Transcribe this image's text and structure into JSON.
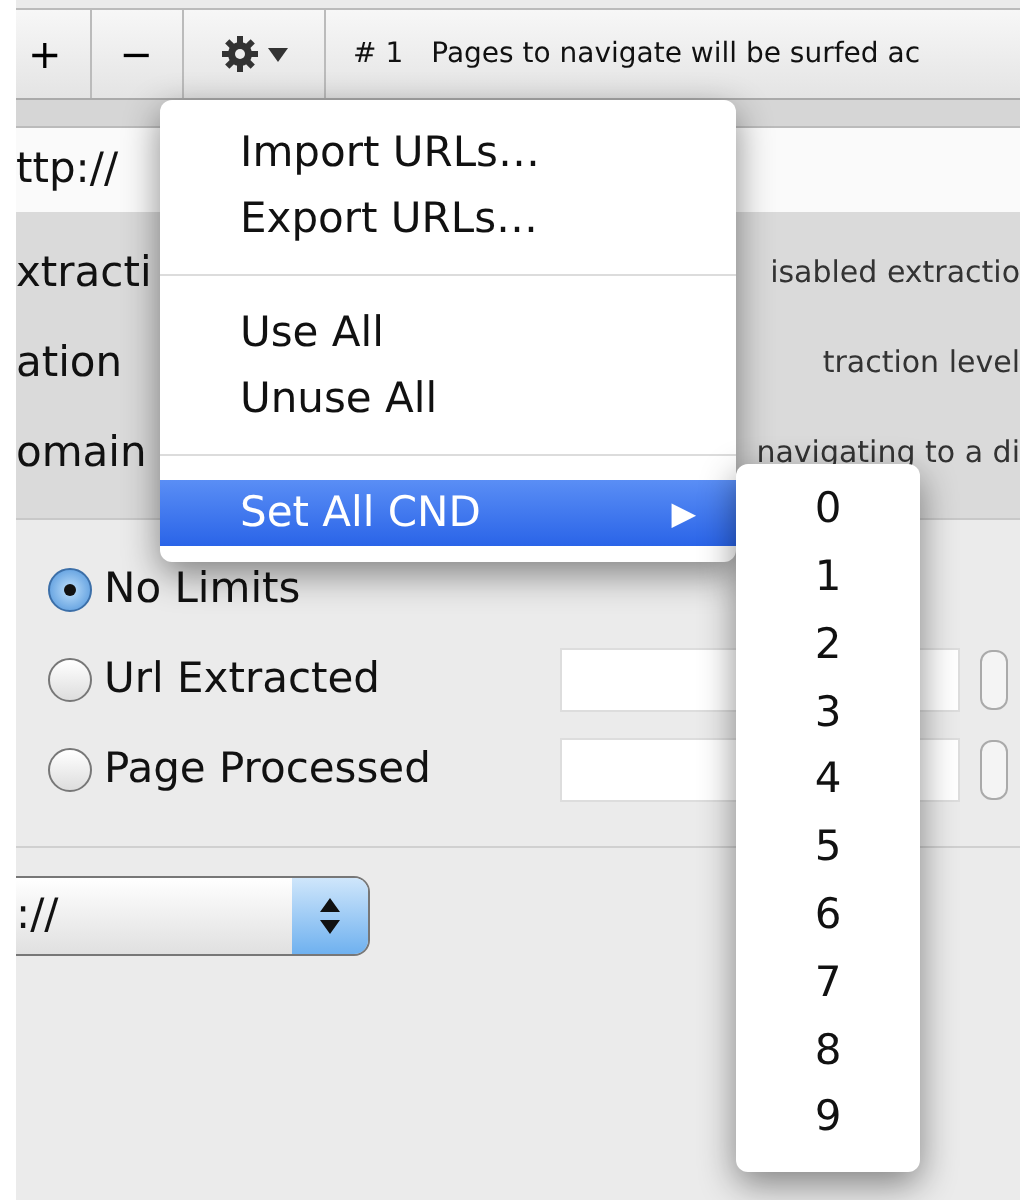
{
  "toolbar": {
    "buttons": [
      {
        "label": "+"
      },
      {
        "label": "−"
      }
    ],
    "index": "# 1",
    "message": "Pages  to navigate will be surfed ac"
  },
  "url_field": {
    "value": "ttp://"
  },
  "options": [
    {
      "label": "xtracti",
      "description": "isabled extractio"
    },
    {
      "label": "ation",
      "description": "traction level"
    },
    {
      "label": "omain",
      "description": "navigating to a di"
    }
  ],
  "limits": [
    {
      "label": "No Limits",
      "selected": true,
      "kind": "plain"
    },
    {
      "label": "Url Extracted",
      "selected": false,
      "kind": "field"
    },
    {
      "label": "Page Processed",
      "selected": false,
      "kind": "field"
    }
  ],
  "protocol_select": {
    "value": "://"
  },
  "menu": {
    "items": [
      {
        "kind": "item",
        "label": "Import URLs…",
        "selected": false
      },
      {
        "kind": "item",
        "label": "Export URLs…",
        "selected": false
      },
      {
        "kind": "separator"
      },
      {
        "kind": "item",
        "label": "Use All",
        "selected": false
      },
      {
        "kind": "item",
        "label": "Unuse All",
        "selected": false
      },
      {
        "kind": "separator"
      },
      {
        "kind": "submenu",
        "label": "Set All CND",
        "selected": true,
        "arrow": "▶"
      }
    ],
    "submenu": [
      "0",
      "1",
      "2",
      "3",
      "4",
      "5",
      "6",
      "7",
      "8",
      "9"
    ]
  }
}
